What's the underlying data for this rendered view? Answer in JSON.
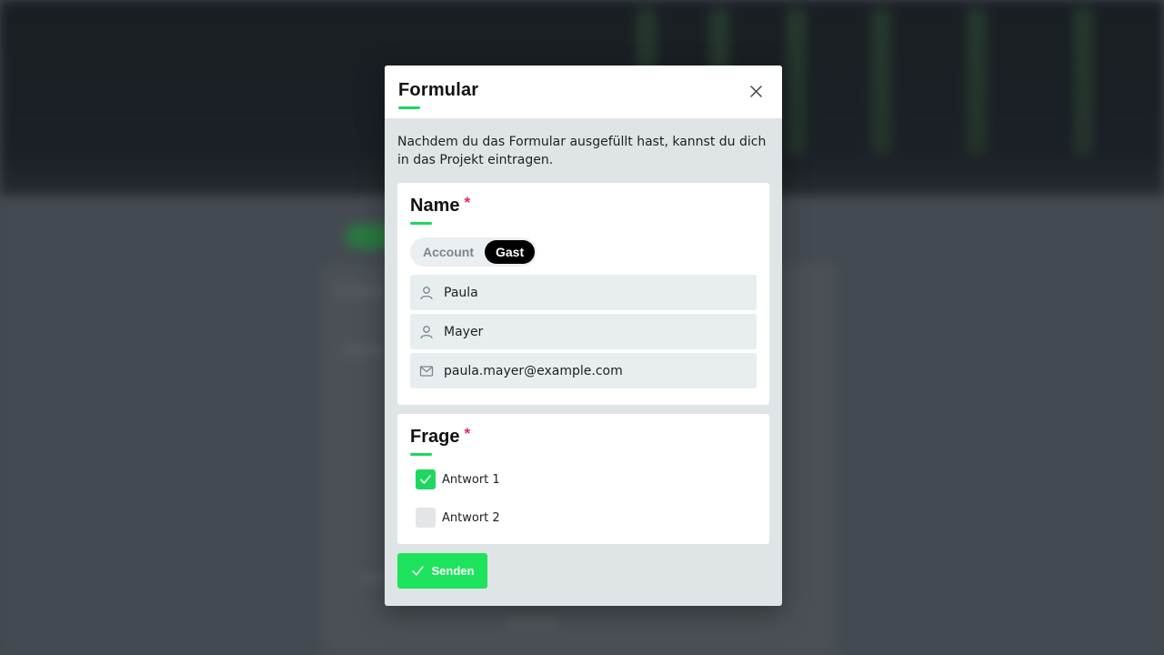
{
  "colors": {
    "accent": "#1ed760",
    "submit": "#1ee35c",
    "required": "#e8245c",
    "toggle_active": "#000000"
  },
  "modal": {
    "title": "Formular",
    "close_icon": "close-icon",
    "intro": "Nachdem du das Formular ausgefüllt hast, kannst du dich in das Projekt eintragen."
  },
  "name_section": {
    "title": "Name",
    "required_mark": "*",
    "toggle": {
      "options": [
        "Account",
        "Gast"
      ],
      "selected": "Gast"
    },
    "fields": [
      {
        "icon": "user-icon",
        "value": "Paula"
      },
      {
        "icon": "user-icon",
        "value": "Mayer"
      },
      {
        "icon": "mail-icon",
        "value": "paula.mayer@example.com"
      }
    ]
  },
  "question_section": {
    "title": "Frage",
    "required_mark": "*",
    "options": [
      {
        "label": "Antwort 1",
        "checked": true
      },
      {
        "label": "Antwort 2",
        "checked": false
      }
    ]
  },
  "submit": {
    "label": "Senden",
    "icon": "check-icon"
  }
}
